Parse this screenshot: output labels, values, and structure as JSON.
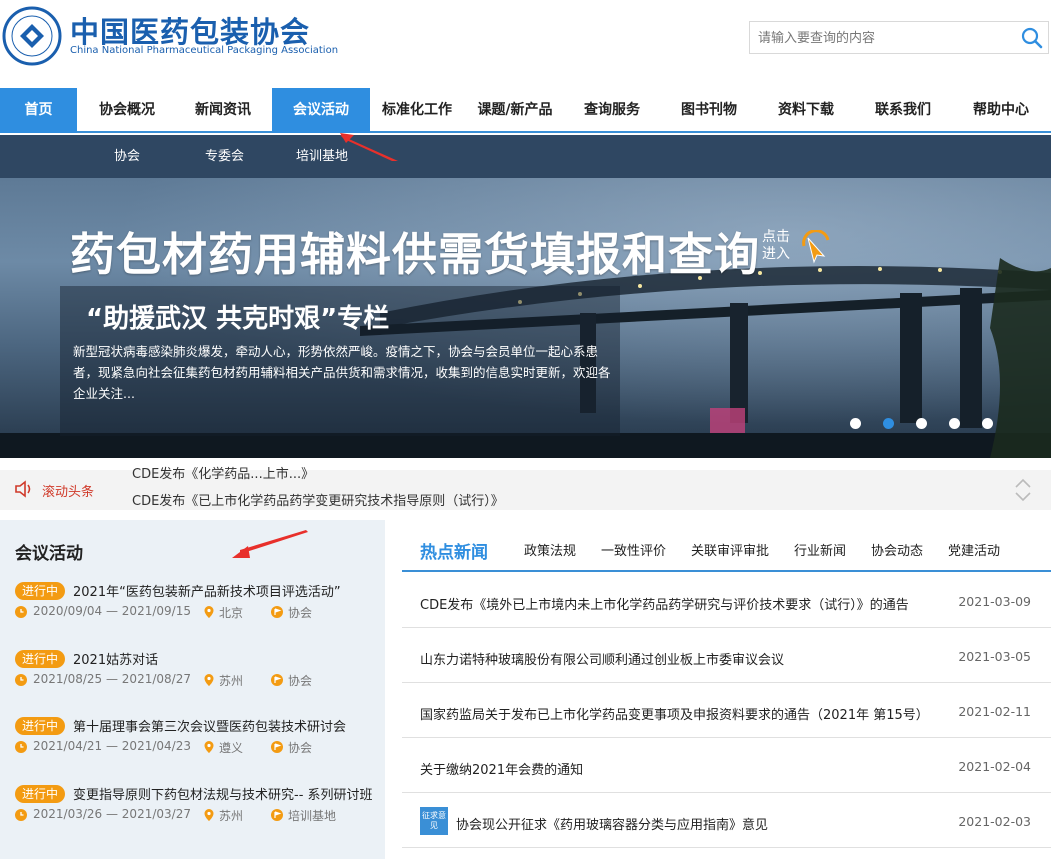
{
  "header": {
    "logo_cn": "中国医药包装协会",
    "logo_en": "China National Pharmaceutical Packaging Association",
    "search_placeholder": "请输入要查询的内容"
  },
  "nav": {
    "items": [
      {
        "label": "首页",
        "state": "home"
      },
      {
        "label": "协会概况"
      },
      {
        "label": "新闻资讯"
      },
      {
        "label": "会议活动",
        "state": "active"
      },
      {
        "label": "标准化工作"
      },
      {
        "label": "课题/新产品"
      },
      {
        "label": "查询服务"
      },
      {
        "label": "图书刊物"
      },
      {
        "label": "资料下载"
      },
      {
        "label": "联系我们"
      },
      {
        "label": "帮助中心"
      }
    ],
    "sub_items": [
      "协会",
      "专委会",
      "培训基地"
    ]
  },
  "banner": {
    "title": "药包材药用辅料供需货填报和查询",
    "cta": "点击进入",
    "panel_title": "“助援武汉 共克时艰”专栏",
    "panel_desc": "新型冠状病毒感染肺炎爆发，牵动人心，形势依然严峻。疫情之下，协会与会员单位一起心系患者，现紧急向社会征集药包材药用辅料相关产品供货和需求情况，收集到的信息实时更新，欢迎各企业关注...",
    "slides_total": 5,
    "slides_active": 2
  },
  "ticker": {
    "label": "滚动头条",
    "lines": [
      "CDE发布《化学药品...上市...》",
      "CDE发布《已上市化学药品药学变更研究技术指导原则（试行）》"
    ]
  },
  "conferences": {
    "title": "会议活动",
    "items": [
      {
        "status": "进行中",
        "name": "2021年“医药包装新产品新技术项目评选活动”",
        "dates": "2020/09/04 — 2021/09/15",
        "location": "北京",
        "organizer": "协会"
      },
      {
        "status": "进行中",
        "name": "2021姑苏对话",
        "dates": "2021/08/25 — 2021/08/27",
        "location": "苏州",
        "organizer": "协会"
      },
      {
        "status": "进行中",
        "name": "第十届理事会第三次会议暨医药包装技术研讨会",
        "dates": "2021/04/21 — 2021/04/23",
        "location": "遵义",
        "organizer": "协会"
      },
      {
        "status": "进行中",
        "name": "变更指导原则下药包材法规与技术研究-- 系列研讨班",
        "dates": "2021/03/26 — 2021/03/27",
        "location": "苏州",
        "organizer": "培训基地"
      }
    ]
  },
  "news": {
    "tabs": [
      "热点新闻",
      "政策法规",
      "一致性评价",
      "关联审评审批",
      "行业新闻",
      "协会动态",
      "党建活动"
    ],
    "items": [
      {
        "title": "CDE发布《境外已上市境内未上市化学药品药学研究与评价技术要求（试行）》的通告",
        "date": "2021-03-09"
      },
      {
        "title": "山东力诺特种玻璃股份有限公司顺利通过创业板上市委审议会议",
        "date": "2021-03-05"
      },
      {
        "title": "国家药监局关于发布已上市化学药品变更事项及申报资料要求的通告（2021年 第15号）",
        "date": "2021-02-11"
      },
      {
        "title": "关于缴纳2021年会费的通知",
        "date": "2021-02-04"
      },
      {
        "title": "协会现公开征求《药用玻璃容器分类与应用指南》意见",
        "date": "2021-02-03",
        "tag": "征求意见"
      }
    ]
  },
  "colors": {
    "brand_blue": "#1a5fae",
    "nav_active": "#2f8ee0",
    "subnav_bg": "#2f4762",
    "badge_orange": "#f39b12",
    "ticker_red": "#d03a2a",
    "arrow_red": "#e8302b"
  }
}
